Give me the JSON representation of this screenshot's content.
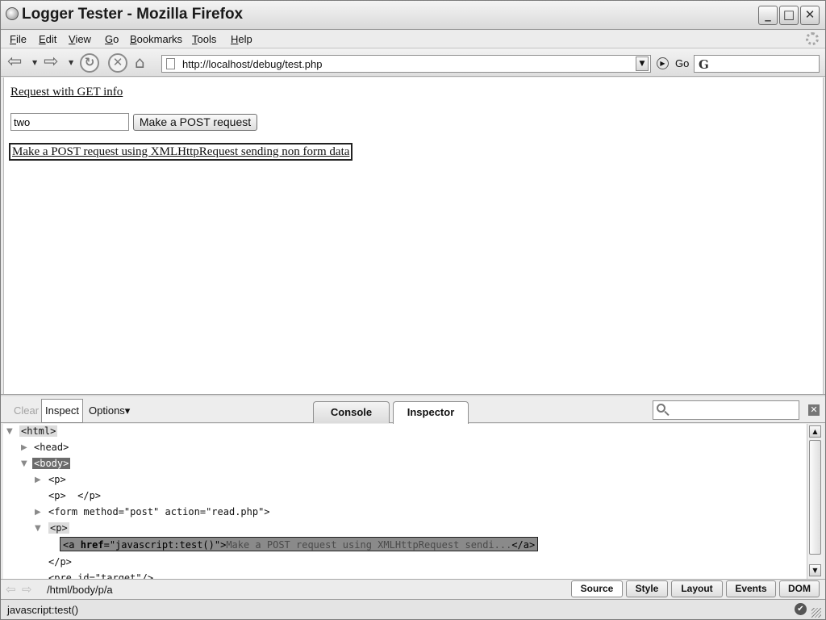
{
  "window": {
    "title": "Logger Tester - Mozilla Firefox",
    "min_glyph": "_",
    "max_glyph": "□",
    "close_glyph": "✕"
  },
  "menubar": [
    {
      "accel": "F",
      "rest": "ile"
    },
    {
      "accel": "E",
      "rest": "dit"
    },
    {
      "accel": "V",
      "rest": "iew"
    },
    {
      "accel": "G",
      "rest": "o"
    },
    {
      "accel": "B",
      "rest": "ookmarks"
    },
    {
      "accel": "T",
      "rest": "ools"
    },
    {
      "accel": "H",
      "rest": "elp"
    }
  ],
  "toolbar": {
    "url": "http://localhost/debug/test.php",
    "go_label": "Go",
    "search_value": ""
  },
  "page": {
    "get_link": "Request with GET info",
    "input_value": "two",
    "post_button": "Make a POST request",
    "xhr_link": "Make a POST request using XMLHttpRequest sending non form data"
  },
  "firebug": {
    "clear": "Clear",
    "inspect": "Inspect",
    "options": "Options▾",
    "tabs": [
      "Console",
      "Inspector"
    ],
    "search_placeholder": "",
    "tree": {
      "html": "<html>",
      "head": "<head>",
      "body": "<body>",
      "p1": "<p>",
      "p2": "<p>  </p>",
      "form": "<form method=\"post\" action=\"read.php\">",
      "p3": "<p>",
      "a_open": "<a ",
      "a_attr_name": "href",
      "a_attr_value": "=\"javascript:test()\">",
      "a_text": "Make a POST request using XMLHttpRequest sendi...",
      "a_close": "</a>",
      "p_close": "</p>",
      "pre": "<pre id=\"target\"/>"
    },
    "path": "/html/body/p/a",
    "bottom_tabs": [
      "Source",
      "Style",
      "Layout",
      "Events",
      "DOM"
    ],
    "active_bottom_tab": "Source"
  },
  "status": {
    "text": "javascript:test()"
  }
}
